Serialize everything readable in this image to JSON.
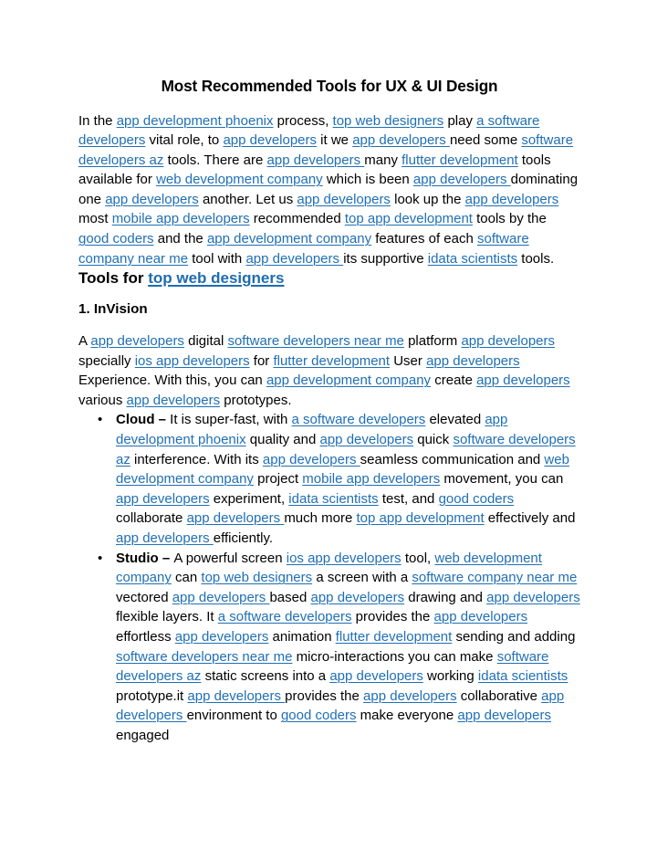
{
  "document": {
    "title": "Most Recommended Tools for UX & UI Design",
    "link_color": "#1F6FB5",
    "heading_link_color": "#1F6CB0",
    "text_color": "#000000",
    "background_color": "#FFFFFF"
  },
  "intro_paragraph": {
    "s1": "In the ",
    "l1": "app development phoenix",
    "s2": " process, ",
    "l2": "top web designers",
    "s3": " play ",
    "l3": "a software developers",
    "s4": " vital role, to ",
    "l4": "app developers",
    "s5": " it we ",
    "l5": "app developers ",
    "s6": "need some ",
    "l6": "software developers az",
    "s7": " tools.  There are ",
    "l7": "app developers ",
    "s8": "many ",
    "l8": "flutter development",
    "s9": " tools available for ",
    "l9": "web development company",
    "s10": " which is been ",
    "l10": "app developers ",
    "s11": "dominating one ",
    "l11": "app developers",
    "s12": "  another. Let us ",
    "l12": "app developers",
    "s13": "  look up the ",
    "l13": "app developers",
    "s14": " most ",
    "l14": "mobile app developers",
    "s15": " recommended ",
    "l15": "top app development",
    "s16": " tools by the ",
    "l16": "good coders",
    "s17": " and the ",
    "l17": "app development company",
    "s18": " features of each ",
    "l18": "software company near me",
    "s19": " tool with ",
    "l19": "app developers ",
    "s20": "its supportive ",
    "l20": "idata scientists",
    "s21": " tools."
  },
  "section_heading": {
    "prefix": "Tools for ",
    "link": "top web designers"
  },
  "subsection_heading": {
    "text": "1. InVision"
  },
  "invision_paragraph": {
    "s1": "A ",
    "l1": "app developers",
    "s2": " digital ",
    "l2": "software developers near me",
    "s3": " platform ",
    "l3": "app developers",
    "s4": " specially ",
    "l4": "ios app developers",
    "s5": " for ",
    "l5": "flutter development",
    "s6": " User ",
    "l6": "app developers",
    "s7": " Experience. With this, you can ",
    "l7": "app development company",
    "s8": " create ",
    "l8": "app developers",
    "s9": " various ",
    "l9": "app developers",
    "s10": " prototypes."
  },
  "bullets": [
    {
      "label": "Cloud – ",
      "s1": "It is super-fast, with ",
      "l1": "a software developers",
      "s2": " elevated ",
      "l2": "app development phoenix",
      "s3": " quality and ",
      "l3": "app developers",
      "s4": "  quick ",
      "l4": "software developers az",
      "s5": " interference. With its ",
      "l5": "app developers ",
      "s6": "seamless communication and ",
      "l6": "web development company",
      "s7": " project ",
      "l7": "mobile app developers",
      "s8": " movement, you can ",
      "l8": "app developers",
      "s9": " experiment, ",
      "l9": "idata scientists",
      "s10": " test, and ",
      "l10": "good coders",
      "s11": " collaborate ",
      "l11": "app developers ",
      "s12": "much more ",
      "l12": "top app development",
      "s13": " effectively and ",
      "l13": "app developers ",
      "s14": "efficiently."
    },
    {
      "label": "Studio – ",
      "s1": "A powerful screen ",
      "l1": "ios app developers",
      "s2": " tool, ",
      "l2": "web development company",
      "s3": " can ",
      "l3": "top web designers",
      "s4": " a screen with a ",
      "l4": "software company near me",
      "s5": " vectored ",
      "l5": "app developers ",
      "s6": "based ",
      "l6": "app developers",
      "s7": "  drawing and ",
      "l7": "app developers",
      "s8": " flexible layers. It ",
      "l8": "a software developers",
      "s9": " provides the ",
      "l9": "app developers",
      "s10": " effortless ",
      "l10": "app developers",
      "s11": "  animation ",
      "l11": "flutter development",
      "s12": " sending and adding ",
      "l12": "software developers near me",
      "s13": " micro-interactions you can make ",
      "l13": "software developers az",
      "s14": " static screens into a ",
      "l14": "app developers",
      "s15": "  working ",
      "l15": "idata scientists",
      "s16": " prototype.it ",
      "l16": "app developers ",
      "s17": "provides the ",
      "l17": "app developers",
      "s18": " collaborative ",
      "l18": "app developers ",
      "s19": "environment to ",
      "l19": "good coders",
      "s20": " make everyone ",
      "l20": "app developers",
      "s21": " engaged"
    }
  ]
}
